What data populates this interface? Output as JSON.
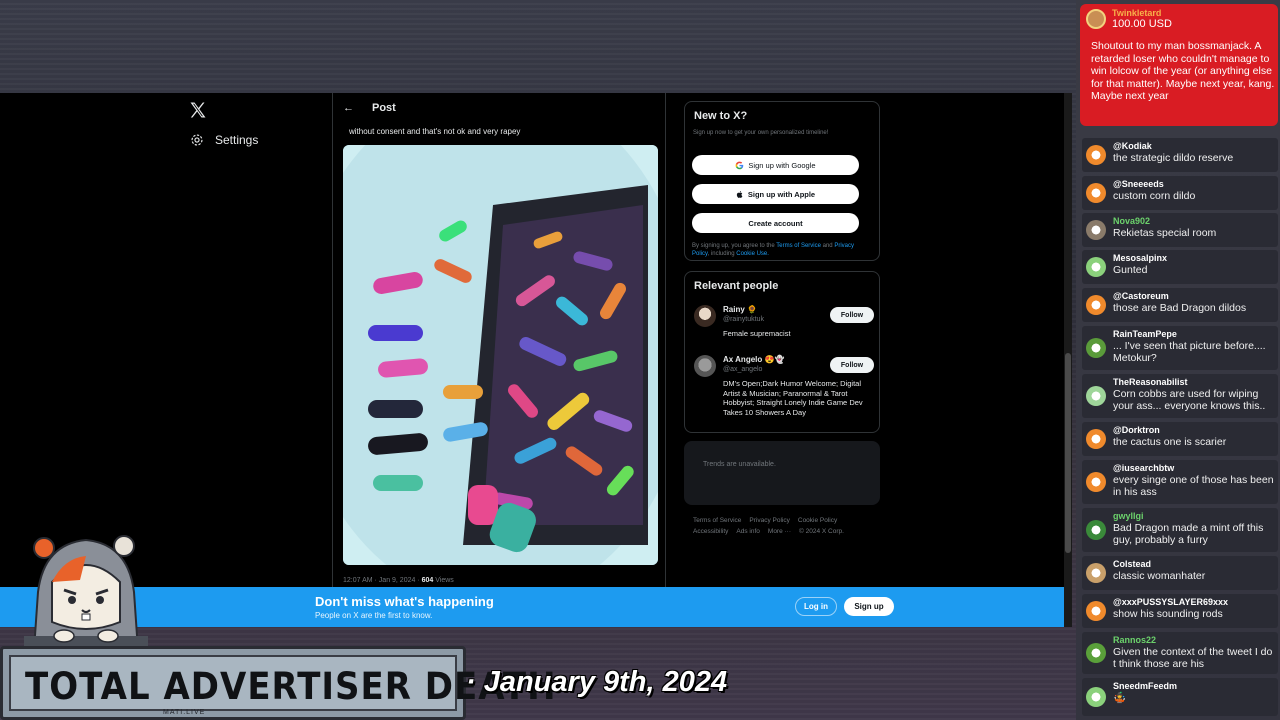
{
  "sidebar": {
    "settings_label": "Settings"
  },
  "post": {
    "header_title": "Post",
    "text": "without consent and that's not ok and very rapey",
    "time": "12:07 AM · Jan 9, 2024 · ",
    "views_count": "604",
    "views_label": " Views"
  },
  "new_to_x": {
    "title": "New to X?",
    "subtitle": "Sign up now to get your own personalized timeline!",
    "google_label": "Sign up with Google",
    "apple_label": "Sign up with Apple",
    "create_label": "Create account",
    "terms_prefix": "By signing up, you agree to the ",
    "terms_link": "Terms of Service",
    "terms_and": " and ",
    "privacy_link": "Privacy Policy",
    "terms_including": ", including ",
    "cookie_link": "Cookie Use."
  },
  "relevant": {
    "title": "Relevant people",
    "people": [
      {
        "name": "Rainy 🌻",
        "handle": "@rainytuktuk",
        "bio": "Female supremacist",
        "follow": "Follow"
      },
      {
        "name": "Ax Angelo 😍👻",
        "handle": "@ax_angelo",
        "bio": "DM's Open;Dark Humor Welcome; Digital Artist & Musician; Paranormal & Tarot Hobbyist; Straight Lonely Indie Game Dev Takes 10 Showers A Day",
        "follow": "Follow"
      }
    ]
  },
  "trends": {
    "text": "Trends are unavailable."
  },
  "footer": {
    "links": [
      "Terms of Service",
      "Privacy Policy",
      "Cookie Policy",
      "Accessibility",
      "Ads info",
      "More ···",
      "© 2024 X Corp."
    ]
  },
  "banner": {
    "title": "Don't miss what's happening",
    "subtitle": "People on X are the first to know.",
    "login": "Log in",
    "signup": "Sign up"
  },
  "overlay": {
    "title": "TOTAL ADVERTISER DEATH",
    "site": "MATI.LIVE",
    "date": "· January 9th, 2024"
  },
  "chat": {
    "donation": {
      "user": "Twinkletard",
      "amount": "100.00 USD",
      "message": "Shoutout to my man bossmanjack. A retarded loser who couldn't manage to win lolcow of the year (or anything else for that matter). Maybe next year, kang. Maybe next year"
    },
    "messages": [
      {
        "user": "@Kodiak",
        "text": "the strategic dildo reserve",
        "user_color": "#ffffff",
        "avatar_color": "#f08a2c"
      },
      {
        "user": "@Sneeeeds",
        "text": "custom corn dildo",
        "user_color": "#ffffff",
        "avatar_color": "#f08a2c"
      },
      {
        "user": "Nova902",
        "text": "Rekietas special room",
        "user_color": "#6cd36c",
        "avatar_color": "#8a7b6a"
      },
      {
        "user": "Mesosalpinx",
        "text": "Gunted",
        "user_color": "#ffffff",
        "avatar_color": "#8bd17c"
      },
      {
        "user": "@Castoreum",
        "text": "those are Bad Dragon dildos",
        "user_color": "#ffffff",
        "avatar_color": "#f08a2c"
      },
      {
        "user": "RainTeamPepe",
        "text": "... I've seen that picture before.... Metokur?",
        "user_color": "#ffffff",
        "avatar_color": "#5a9b3a"
      },
      {
        "user": "TheReasonabilist",
        "text": "Corn cobbs are used for wiping your ass... everyone knows this..",
        "user_color": "#ffffff",
        "avatar_color": "#9fd69a"
      },
      {
        "user": "@Dorktron",
        "text": "the cactus one is scarier",
        "user_color": "#ffffff",
        "avatar_color": "#f08a2c"
      },
      {
        "user": "@iusearchbtw",
        "text": "every singe one of those has been in his ass",
        "user_color": "#ffffff",
        "avatar_color": "#f08a2c"
      },
      {
        "user": "gwyllgi",
        "text": "Bad Dragon made a mint off this guy, probably a furry",
        "user_color": "#6cd36c",
        "avatar_color": "#3a8a3a"
      },
      {
        "user": "Colstead",
        "text": "classic womanhater",
        "user_color": "#ffffff",
        "avatar_color": "#c9a06a"
      },
      {
        "user": "@xxxPUSSYSLAYER69xxx",
        "text": "show his sounding rods",
        "user_color": "#ffffff",
        "avatar_color": "#f08a2c"
      },
      {
        "user": "Rannos22",
        "text": "Given the context of the tweet I do t think those are his",
        "user_color": "#6cd36c",
        "avatar_color": "#5aa03a"
      },
      {
        "user": "SneedmFeedm",
        "text": "🤹",
        "user_color": "#ffffff",
        "avatar_color": "#8bd17c"
      }
    ]
  }
}
